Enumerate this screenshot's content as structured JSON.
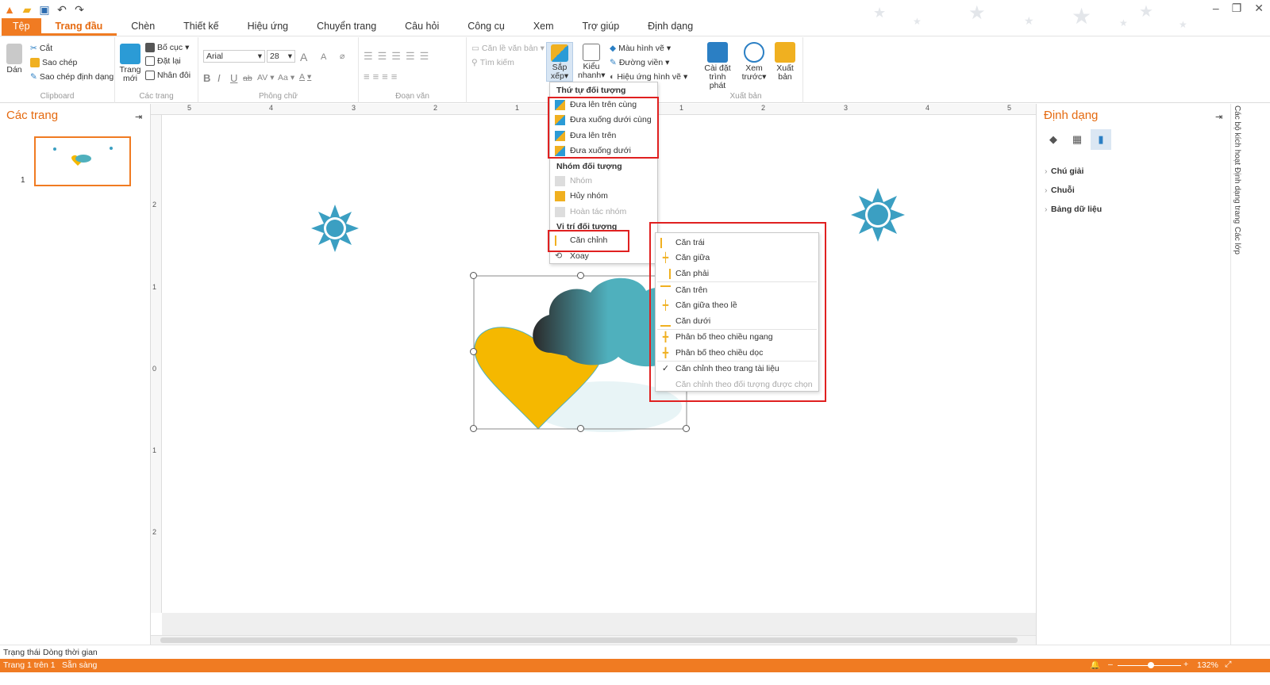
{
  "tabs": [
    "Tệp",
    "Trang đầu",
    "Chèn",
    "Thiết kế",
    "Hiệu ứng",
    "Chuyển trang",
    "Câu hỏi",
    "Công cụ",
    "Xem",
    "Trợ giúp",
    "Định dạng"
  ],
  "ribbon": {
    "clipboard": {
      "label": "Clipboard",
      "paste": "Dán",
      "cut": "Cắt",
      "copy": "Sao chép",
      "format_painter": "Sao chép định dạng"
    },
    "pages": {
      "label": "Các trang",
      "new_page_1": "Trang",
      "new_page_2": "mới",
      "layout": "Bố cục",
      "reset": "Đặt lại",
      "duplicate": "Nhân đôi"
    },
    "font": {
      "label": "Phông chữ",
      "family": "Arial",
      "size": "28",
      "bold": "B",
      "italic": "I",
      "underline": "U",
      "strike": "ab",
      "spacing": "AV",
      "case": "Aa",
      "color": "A",
      "grow": "A",
      "shrink": "A"
    },
    "paragraph": {
      "label": "Đoạn văn"
    },
    "arrange": {
      "align_text": "Căn lề văn bản",
      "find": "Tìm kiếm",
      "arrange_1": "Sắp",
      "arrange_2": "xếp",
      "quick_1": "Kiểu",
      "quick_2": "nhanh",
      "shape_color": "Màu hình vẽ",
      "border": "Đường viền",
      "shape_effect": "Hiệu ứng hình vẽ"
    },
    "publish": {
      "label": "Xuất bản",
      "settings_1": "Cài đặt",
      "settings_2": "trình phát",
      "preview_1": "Xem",
      "preview_2": "trước",
      "publish_1": "Xuất",
      "publish_2": "bản"
    }
  },
  "left_panel": {
    "title": "Các trang",
    "page_number": "1"
  },
  "ruler": {
    "h": [
      "5",
      "4",
      "3",
      "2",
      "1",
      "1",
      "2",
      "3",
      "4",
      "5"
    ],
    "v": [
      "2",
      "1",
      "0",
      "1",
      "2"
    ]
  },
  "right_panel": {
    "title": "Định dạng",
    "items": [
      "Chú giải",
      "Chuỗi",
      "Bảng dữ liệu"
    ],
    "side_tabs": [
      "Các bộ kích hoạt",
      "Định dạng trang",
      "Các lớp"
    ]
  },
  "arrange_menu": {
    "order_header": "Thứ tự đối tượng",
    "order_items": [
      "Đưa lên trên cùng",
      "Đưa xuống dưới cùng",
      "Đưa lên trên",
      "Đưa xuống dưới"
    ],
    "group_header": "Nhóm đối tượng",
    "group_items": [
      "Nhóm",
      "Hủy nhóm",
      "Hoàn tác nhóm"
    ],
    "position_header": "Vị trí đối tượng",
    "position_items": [
      "Căn chỉnh",
      "Xoay"
    ]
  },
  "align_menu": {
    "items": [
      "Căn trái",
      "Căn giữa",
      "Căn phải",
      "Căn trên",
      "Căn giữa theo lề",
      "Căn dưới",
      "Phân bố theo chiều ngang",
      "Phân bố theo chiều dọc",
      "Căn chỉnh theo trang tài liệu",
      "Căn chỉnh theo đối tượng được chọn"
    ]
  },
  "status": {
    "row_left": "Trạng thái",
    "row_right": "Dòng thời gian",
    "page": "Trang 1 trên 1",
    "ready": "Sẵn sàng",
    "zoom": "132%"
  },
  "colors": {
    "accent": "#f07b22",
    "sun": "#3b9fc2",
    "heart": "#f5b800",
    "cloud": "#4fb0bd",
    "highlight_box": "#e02020"
  }
}
